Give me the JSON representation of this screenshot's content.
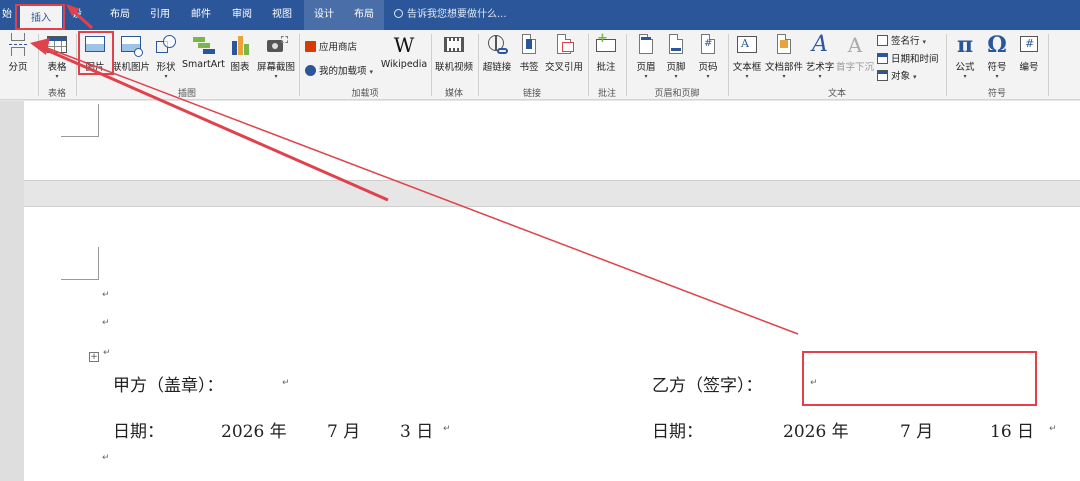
{
  "tabs": {
    "start": "始",
    "insert": "插入",
    "design_partial": "设",
    "layout": "布局",
    "references": "引用",
    "mailings": "邮件",
    "review": "审阅",
    "view": "视图",
    "ctx_design": "设计",
    "ctx_layout": "布局"
  },
  "tell_me": "告诉我您想要做什么...",
  "ribbon": {
    "page_break": "分页",
    "table": "表格",
    "picture": "图片",
    "online_picture": "联机图片",
    "shapes": "形状",
    "smartart": "SmartArt",
    "chart": "图表",
    "screenshot": "屏幕截图",
    "app_store": "应用商店",
    "my_addins": "我的加载项",
    "wikipedia": "Wikipedia",
    "online_video": "联机视频",
    "hyperlink": "超链接",
    "bookmark": "书签",
    "cross_ref": "交叉引用",
    "comment": "批注",
    "header": "页眉",
    "footer": "页脚",
    "page_number": "页码",
    "text_box": "文本框",
    "quick_parts": "文档部件",
    "wordart": "艺术字",
    "dropcap": "首字下沉",
    "signature_line": "签名行",
    "date_time": "日期和时间",
    "object": "对象",
    "equation": "公式",
    "symbol": "符号",
    "numbering": "编号",
    "wiki_glyph": "W",
    "pi_glyph": "π",
    "omega_glyph": "Ω",
    "wordart_glyph": "A",
    "number_glyph": "#"
  },
  "groups": {
    "tables": "表格",
    "illustrations": "插图",
    "addins": "加载项",
    "media": "媒体",
    "links": "链接",
    "comments": "批注",
    "header_footer": "页眉和页脚",
    "text": "文本",
    "symbols": "符号"
  },
  "document": {
    "para_mark": "↵",
    "party_a_label": "甲方（盖章）：",
    "party_b_label": "乙方（签字）：",
    "date_label_a": "日期：",
    "date_label_b": "日期：",
    "a_year": "2026 年",
    "a_month": "7 月",
    "a_day": "3 日",
    "b_year": "2026 年",
    "b_month": "7  月",
    "b_day": "16  日"
  },
  "colors": {
    "accent": "#2b579a",
    "annotation": "#e0424b"
  }
}
